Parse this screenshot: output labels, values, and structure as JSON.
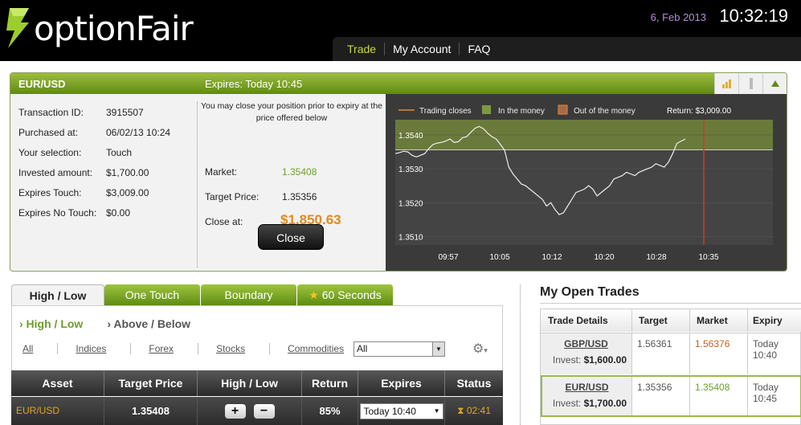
{
  "header": {
    "logo_text": "optionFair",
    "date": "6, Feb 2013",
    "time": "10:32:19",
    "nav": [
      "Trade",
      "My Account",
      "FAQ"
    ]
  },
  "panel": {
    "pair": "EUR/USD",
    "expires": "Expires:  Today 10:45",
    "details": [
      {
        "label": "Transaction ID:",
        "value": "3915507"
      },
      {
        "label": "Purchased at:",
        "value": "06/02/13 10:24"
      },
      {
        "label": "Your selection:",
        "value": "Touch"
      },
      {
        "label": "Invested amount:",
        "value": "$1,700.00"
      },
      {
        "label": "Expires Touch:",
        "value": "$3,009.00"
      },
      {
        "label": "Expires No Touch:",
        "value": "$0.00"
      }
    ],
    "note": "You may close your position prior to expiry at the price offered below",
    "market_label": "Market:",
    "market_value": "1.35408",
    "target_label": "Target Price:",
    "target_value": "1.35356",
    "closeat_label": "Close at:",
    "closeat_value": "$1,850.63",
    "close_button": "Close"
  },
  "chart_data": {
    "type": "line",
    "legend": [
      "Trading closes",
      "In the money",
      "Out of the money"
    ],
    "return_text": "Return: $3,009.00",
    "x_ticks": [
      "09:57",
      "10:05",
      "10:12",
      "10:20",
      "10:28",
      "10:35"
    ],
    "y_ticks": [
      "1.3540",
      "1.3530",
      "1.3520",
      "1.3510"
    ],
    "y_tick_values": [
      1.354,
      1.353,
      1.352,
      1.351
    ],
    "ylim": [
      1.35075,
      1.35445
    ],
    "target": 1.35356,
    "series": [
      {
        "values": [
          1.35345,
          1.35348,
          1.35352,
          1.3535,
          1.3534,
          1.35335,
          1.3534,
          1.35345,
          1.3536,
          1.35372,
          1.35376,
          1.35378,
          1.35382,
          1.35388,
          1.35378,
          1.3538,
          1.35392,
          1.35395,
          1.35408,
          1.3542,
          1.35425,
          1.35418,
          1.35405,
          1.35395,
          1.35388,
          1.35372,
          1.35355,
          1.35305,
          1.35285,
          1.3527,
          1.35255,
          1.3525,
          1.3524,
          1.3523,
          1.3522,
          1.3521,
          1.3519,
          1.352,
          1.3518,
          1.35165,
          1.3517,
          1.3519,
          1.3521,
          1.3523,
          1.35235,
          1.3524,
          1.3525,
          1.3524,
          1.3522,
          1.3523,
          1.3524,
          1.3525,
          1.3527,
          1.35275,
          1.3528,
          1.3529,
          1.35285,
          1.3528,
          1.3529,
          1.35295,
          1.353,
          1.35305,
          1.35315,
          1.3531,
          1.35305,
          1.3532,
          1.35345,
          1.35375,
          1.35382,
          1.35388
        ]
      }
    ]
  },
  "tabs": [
    "High / Low",
    "One Touch",
    "Boundary",
    "60 Seconds"
  ],
  "subnav": [
    "› High / Low",
    "› Above / Below"
  ],
  "filters": [
    "All",
    "Indices",
    "Forex",
    "Stocks",
    "Commodities"
  ],
  "asset_select": "All",
  "table": {
    "headers": [
      "Asset",
      "Target Price",
      "High / Low",
      "Return",
      "Expires",
      "Status"
    ],
    "row": {
      "asset": "EUR/USD",
      "target": "1.35408",
      "return": "85%",
      "expires": "Today 10:40",
      "status": "02:41"
    }
  },
  "open_trades": {
    "title": "My Open Trades",
    "headers": [
      "Trade Details",
      "Target",
      "Market",
      "Expiry"
    ],
    "rows": [
      {
        "pair": "GBP/USD",
        "invest_label": "Invest:",
        "invest": "$1,600.00",
        "target": "1.56361",
        "market": "1.56376",
        "expiry1": "Today",
        "expiry2": "10:40"
      },
      {
        "pair": "EUR/USD",
        "invest_label": "Invest:",
        "invest": "$1,700.00",
        "target": "1.35356",
        "market": "1.35408",
        "expiry1": "Today",
        "expiry2": "10:45"
      }
    ]
  },
  "colors": {
    "brand_green": "#7aa22a",
    "accent_orange": "#e08a1c",
    "market_green": "#6d9e2a"
  }
}
